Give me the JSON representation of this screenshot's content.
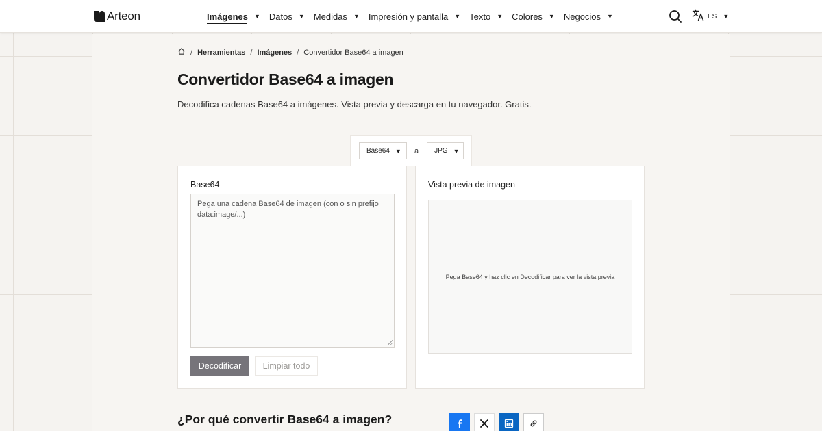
{
  "header": {
    "brand": "Arteon",
    "nav": [
      {
        "label": "Imágenes",
        "active": true
      },
      {
        "label": "Datos"
      },
      {
        "label": "Medidas"
      },
      {
        "label": "Impresión y pantalla"
      },
      {
        "label": "Texto"
      },
      {
        "label": "Colores"
      },
      {
        "label": "Negocios"
      }
    ],
    "lang": "ES"
  },
  "breadcrumb": {
    "items": [
      "Herramientas",
      "Imágenes"
    ],
    "current": "Convertidor Base64 a imagen"
  },
  "page": {
    "title": "Convertidor Base64 a imagen",
    "subtitle": "Decodifica cadenas Base64 a imágenes. Vista previa y descarga en tu navegador. Gratis."
  },
  "converter": {
    "from": "Base64",
    "sep": "a",
    "to": "JPG",
    "input_label": "Base64",
    "input_placeholder": "Pega una cadena Base64 de imagen (con o sin prefijo data:image/...)",
    "decode_label": "Decodificar",
    "clear_label": "Limpiar todo",
    "preview_label": "Vista previa de imagen",
    "preview_empty": "Pega Base64 y haz clic en Decodificar para ver la vista previa"
  },
  "section": {
    "title": "¿Por qué convertir Base64 a imagen?"
  },
  "share": {
    "icons": [
      "facebook-icon",
      "x-icon",
      "linkedin-icon",
      "link-icon"
    ]
  },
  "colors": {
    "decode_button": "#76747a",
    "facebook": "#1877f2",
    "linkedin": "#0a66c2"
  }
}
